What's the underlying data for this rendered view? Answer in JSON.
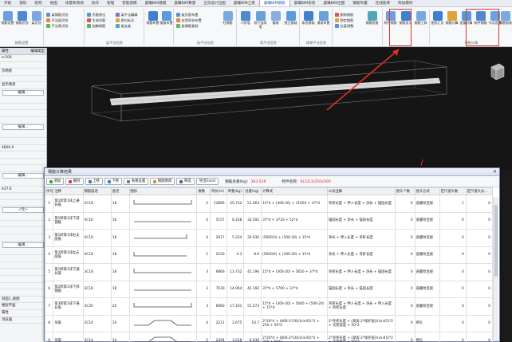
{
  "ribbon": {
    "tabs": [
      "开始",
      "建筑",
      "结构",
      "视图",
      "体量和场地",
      "协作",
      "管理",
      "智能建模",
      "晨曦BIM建模",
      "晨曦BIM算量",
      "正向设计出图",
      "晨曦BIM土建",
      "晨曦BIM钢筋",
      "晨曦BIM安装",
      "晨曦BIM出图",
      "钢筋布置",
      "在线族库",
      "附加模块"
    ],
    "active_tab": "晨曦BIM钢筋",
    "buttons": [
      "钢筋设置",
      "钢筋识别",
      "梁识别",
      "板识别",
      "柱识别",
      "墙识别",
      "钢筋布置",
      "楼板布置",
      "柱钢筋",
      "人防墙",
      "地下连续墙",
      "楼梯",
      "独立基础",
      "条形基础",
      "通用布置",
      "钢筋检查",
      "构件钢筋",
      "钢筋显示",
      "钢筋工具",
      "图形汇总",
      "钢筋计算",
      "批量计算",
      "构件钢筋",
      "节点设置",
      "钢筋报表"
    ],
    "small_items": [
      "梁钢筋识别",
      "平法梁识别",
      "平法表识别",
      "吊筋原位",
      "生成吊筋",
      "加腋钢筋",
      "梁平法编辑",
      "原位标注",
      "梁支座",
      "板负筋布置",
      "应用同名布置",
      "板钢筋复制",
      "删除钢筋",
      "锁定钢筋",
      "长度调整"
    ],
    "group_labels": [
      "配筋设置",
      "梁平法信息",
      "板平法信息",
      "墙平法信息",
      "楼梯平法信息",
      "钢筋计算"
    ]
  },
  "left_panel": {
    "title": "属性",
    "header_right": "编辑类型",
    "rows": [
      "e:100",
      "",
      "示两者",
      "",
      "显示两者",
      "",
      "",
      "",
      "",
      "",
      "",
      "4800.0",
      "",
      "",
      "",
      "",
      "437.6",
      "",
      "",
      "",
      "",
      "",
      "",
      "",
      "",
      "",
      "",
      "",
      "",
      ""
    ],
    "buttons": [
      "编辑...",
      "编辑...",
      "编辑...",
      "<无>",
      "编辑..."
    ],
    "footer_items": [
      "剖面1_视图",
      "楼层平面",
      "属性",
      "浏览器"
    ]
  },
  "dialog": {
    "title": "钢筋计算结果",
    "close": "✕",
    "toolbar": [
      "添加",
      "删除",
      "上移",
      "下移",
      "表格设置",
      "钢筋图库",
      "筛选",
      "导出Excel"
    ],
    "total_label": "钢筋总重(Kg):",
    "total_value": "383.539",
    "component_label": "构件名称:",
    "component_value": "KL12(3)250x500",
    "columns": [
      "序号",
      "注释",
      "钢筋描述",
      "直径",
      "图形",
      "根数",
      "单长(m)",
      "单重(kg)",
      "总重(kg)",
      "计算式",
      "公式注解",
      "接头个数",
      "接头方式",
      "定尺接头数",
      "定尺接头长..."
    ],
    "rows": [
      [
        "1",
        "第1跨第1排上通长筋",
        "2C18",
        "18",
        "",
        "2",
        "12866",
        "25.732",
        "51.464",
        "15*d + (300-20) + 11650 + 37*d",
        "弯折长度 + 伸入长度 + 净长 + 锚固长度",
        "0",
        "直螺纹连接",
        "1",
        "0"
      ],
      [
        "2",
        "第1跨第1排下部钢筋",
        "4C16",
        "16",
        "",
        "4",
        "5157",
        "8.148",
        "32.592",
        "37*d + 3733 + 52*d",
        "锚固长度 + 净长 + 锚固长度",
        "0",
        "直螺纹连接",
        "0",
        "0"
      ],
      [
        "3",
        "第1跨第1排右支座筋",
        "4C18",
        "18",
        "",
        "4",
        "2617",
        "5.234",
        "20.936",
        "(5600/3) + (500-20) + 15*d",
        "净长 + 伸入长度 + 弯折长度",
        "0",
        "直螺纹连接",
        "0",
        "0"
      ],
      [
        "4",
        "第2跨第1排左支座筋",
        "4C18",
        "18",
        "",
        "2",
        "2150",
        "4.3",
        "8.6",
        "(5600/4) + (300-20) + 15*d",
        "净长 + 伸入长度 + 弯折长度",
        "0",
        "直螺纹连接",
        "0",
        "0"
      ],
      [
        "5",
        "第1跨第1排下通长筋",
        "3C18",
        "18",
        "",
        "3",
        "6866",
        "13.732",
        "41.196",
        "15*d + (300-20) + 5650 + 37*d",
        "弯折长度 + 伸入长度 + 净长 + 锚固长度",
        "0",
        "直螺纹连接",
        "0",
        "0"
      ],
      [
        "6",
        "第2跨第1排下部钢筋",
        "3C18",
        "18",
        "",
        "3",
        "7030",
        "14.064",
        "42.192",
        "37*d + 5700 + 37*d",
        "锚固长度 + 净长 + 锚固长度",
        "0",
        "直螺纹连接",
        "0",
        "0"
      ],
      [
        "7",
        "第3跨第1排下通长筋",
        "3C20",
        "20",
        "",
        "3",
        "6960",
        "17.191",
        "51.573",
        "15*d + (300-20) + 5600 + (500-20) + 15*d",
        "弯折长度 + 伸入长度 + 净长 + 伸入长度 + 弯折长度",
        "0",
        "直螺纹连接",
        "0",
        "0"
      ],
      [
        "8",
        "吊筋",
        "2C14",
        "14",
        "",
        "4",
        "2211",
        "2.675",
        "10.7",
        "2*20*d + (600-2*20)/(sin45)*2 + 250 + 50*2",
        "2*弯折长度 + (梁高-2*保护层)/(sin45)*2 + 次梁宽度 + 50*2",
        "0",
        "绑扎",
        "0",
        "0"
      ],
      [
        "9",
        "吊筋",
        "2C14",
        "14",
        "",
        "2",
        "2494",
        "3.018",
        "6.036",
        "2*20*d + (800-2*20)/(sin45)*2 + 250 + 50*2",
        "2*弯折长度 + (梁高-2*保护层)/(sin45)*2 + 次梁宽度 + 50*2",
        "0",
        "绑扎",
        "0",
        "0"
      ]
    ]
  },
  "colors": {
    "accent": "#1f58b8",
    "highlight": "#e0302a",
    "viewport": "#151515"
  }
}
